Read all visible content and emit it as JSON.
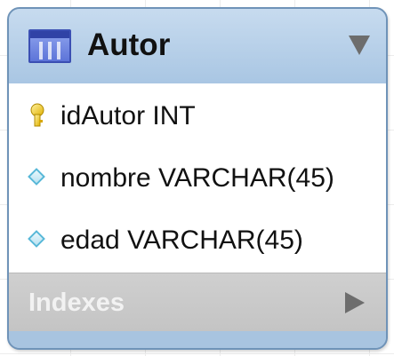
{
  "table": {
    "name": "Autor",
    "icon": "table-icon",
    "header_color": "#a9c6e3",
    "columns": [
      {
        "icon": "primary-key-icon",
        "label": "idAutor INT"
      },
      {
        "icon": "column-diamond-icon",
        "label": "nombre VARCHAR(45)"
      },
      {
        "icon": "column-diamond-icon",
        "label": "edad VARCHAR(45)"
      }
    ],
    "indexes_label": "Indexes",
    "collapse_icon": "triangle-down-icon",
    "expand_icon": "triangle-right-icon"
  }
}
